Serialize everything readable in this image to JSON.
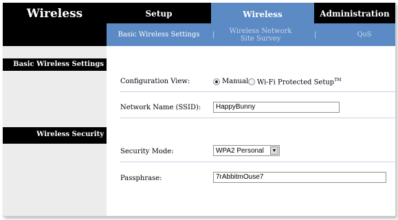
{
  "brand": {
    "title": "Wireless"
  },
  "tabs": [
    {
      "label": "Setup"
    },
    {
      "label": "Wireless",
      "active": true
    },
    {
      "label": "Administration"
    }
  ],
  "subtabs": [
    {
      "label": "Basic Wireless Settings",
      "active": true
    },
    {
      "label": "Wireless Network Site Survey"
    },
    {
      "label": "QoS"
    }
  ],
  "separator": "|",
  "sections": {
    "basic": "Basic Wireless Settings",
    "security": "Wireless Security"
  },
  "form": {
    "config_view_label": "Configuration View:",
    "manual_label": "Manual",
    "wps_label": "Wi-Fi Protected Setup",
    "wps_tm": "TM",
    "config_view_value": "Manual",
    "ssid_label": "Network Name (SSID):",
    "ssid_value": "HappyBunny",
    "security_mode_label": "Security Mode:",
    "security_mode_value": "WPA2 Personal",
    "passphrase_label": "Passphrase:",
    "passphrase_value": "7rAbbitmOuse7"
  },
  "colors": {
    "header_black": "#000000",
    "accent_blue": "#5b8ac4",
    "left_column_gray": "#ececec",
    "divider_blue": "#c6d3e6"
  },
  "icons": {
    "select_arrow": "chevron-down-icon"
  }
}
